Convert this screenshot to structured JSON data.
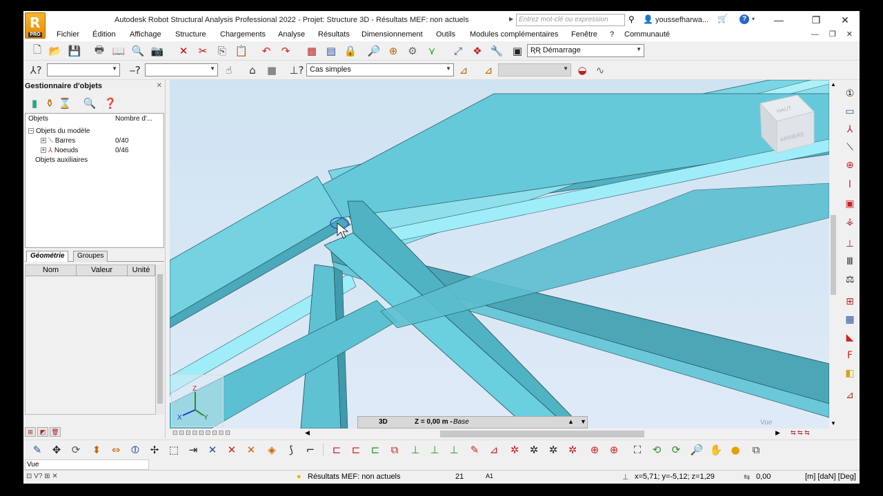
{
  "title": "Autodesk Robot Structural Analysis Professional 2022 - Projet: Structure 3D - Résultats MEF: non actuels",
  "logo": {
    "letter": "R",
    "edition": "PRO"
  },
  "search_placeholder": "Entrez mot-clé ou expression",
  "username": "youssefharwa...",
  "menu": [
    "Fichier",
    "Édition",
    "Affichage",
    "Structure",
    "Chargements",
    "Analyse",
    "Résultats",
    "Dimensionnement",
    "Outils",
    "Modules complémentaires",
    "Fenêtre",
    "?",
    "Communauté"
  ],
  "toolbar1": {
    "layout_combo": "Démarrage"
  },
  "toolbar2": {
    "cases_combo": "Cas simples"
  },
  "object_manager": {
    "title": "Gestionnaire d'objets",
    "col_objects": "Objets",
    "col_count": "Nombre d'...",
    "model_objects": "Objets du modèle",
    "bars_label": "Barres",
    "bars_count": "0/40",
    "nodes_label": "Noeuds",
    "nodes_count": "0/46",
    "aux_objects": "Objets auxiliaires"
  },
  "tabs": {
    "geometry": "Géométrie",
    "groups": "Groupes"
  },
  "geometry_table": {
    "name": "Nom",
    "value": "Valeur",
    "unit": "Unité"
  },
  "viewcube": {
    "top": "HAUT",
    "back": "ARRIÈRE"
  },
  "view_bar": {
    "mode": "3D",
    "level": "Z = 0,00 m - ",
    "level_name": "Base"
  },
  "vue_watermark": "Vue",
  "axis": {
    "x": "X",
    "y": "Y",
    "z": "Z"
  },
  "status": {
    "field": "Vue",
    "results": "Résultats MEF: non actuels",
    "count": "21",
    "node_label": "A1",
    "coords": "x=5,71; y=-5,12; z=1,29",
    "angle": "0,00",
    "units": "[m] [daN] [Deg]"
  },
  "colors": {
    "steel": "#6fd0e0",
    "steel_dark": "#4fb4c6",
    "steel_light": "#9ee8f3",
    "background": "#d5e6f3",
    "edge": "#1f4d55"
  }
}
